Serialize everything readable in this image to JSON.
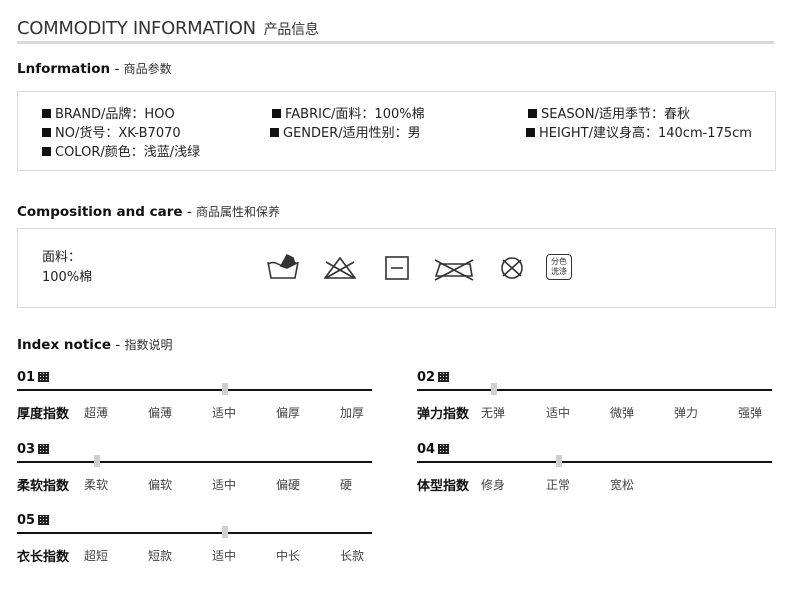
{
  "header": {
    "title_en": "COMMODITY INFORMATION",
    "title_zh": "产品信息"
  },
  "information": {
    "title_en": "Lnformation",
    "dash": " - ",
    "title_zh": "商品参数",
    "items": [
      "BRAND/品牌：HOO",
      "FABRIC/面料：100%棉",
      "SEASON/适用季节：春秋",
      "NO/货号：XK-B7070",
      "GENDER/适用性别：男",
      "HEIGHT/建议身高：140cm-175cm",
      "COLOR/颜色：浅蓝/浅绿"
    ]
  },
  "composition": {
    "title_en": "Composition and care",
    "dash": " - ",
    "title_zh": "商品属性和保养",
    "fabric_label": "面料：",
    "fabric_value": "100%棉",
    "icons": [
      "hand-wash-icon",
      "no-bleach-icon",
      "tumble-dry-icon",
      "no-iron-icon",
      "no-dry-clean-icon",
      "wash-separately-icon"
    ],
    "wash_separately_text": [
      "分色",
      "洗涤"
    ]
  },
  "index_notice": {
    "title_en": "Index notice",
    "dash": " - ",
    "title_zh": "指数说明",
    "indices": [
      {
        "number": "01",
        "label": "厚度指数",
        "options": [
          "超薄",
          "偏薄",
          "适中",
          "偏厚",
          "加厚"
        ],
        "selected": 2
      },
      {
        "number": "02",
        "label": "弹力指数",
        "options": [
          "无弹",
          "适中",
          "微弹",
          "弹力",
          "强弹"
        ],
        "selected": 0
      },
      {
        "number": "03",
        "label": "柔软指数",
        "options": [
          "柔软",
          "偏软",
          "适中",
          "偏硬",
          "硬"
        ],
        "selected": 0
      },
      {
        "number": "04",
        "label": "体型指数",
        "options": [
          "修身",
          "正常",
          "宽松"
        ],
        "selected": 1
      },
      {
        "number": "05",
        "label": "衣长指数",
        "options": [
          "超短",
          "短款",
          "适中",
          "中长",
          "长款"
        ],
        "selected": 2
      }
    ]
  }
}
